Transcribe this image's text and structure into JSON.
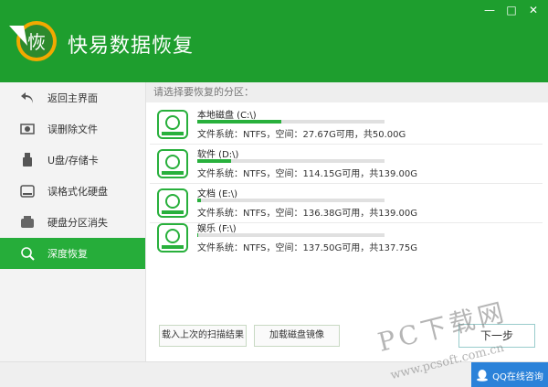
{
  "app": {
    "title": "快易数据恢复"
  },
  "window_controls": [
    "minimize-icon",
    "restore-icon",
    "close-icon"
  ],
  "sidebar": {
    "items": [
      {
        "label": "返回主界面",
        "icon": "back-arrow-icon"
      },
      {
        "label": "误删除文件",
        "icon": "deleted-file-icon"
      },
      {
        "label": "U盘/存储卡",
        "icon": "usb-drive-icon"
      },
      {
        "label": "误格式化硬盘",
        "icon": "hard-disk-icon"
      },
      {
        "label": "硬盘分区消失",
        "icon": "partition-icon"
      },
      {
        "label": "深度恢复",
        "icon": "deep-recovery-icon",
        "active": true
      }
    ]
  },
  "main": {
    "prompt": "请选择要恢复的分区：",
    "partitions": [
      {
        "name": "本地磁盘 (C:\\)",
        "info": "文件系统：NTFS，空间：27.67G可用，共50.00G",
        "used_fraction": 0.4466
      },
      {
        "name": "软件 (D:\\)",
        "info": "文件系统：NTFS，空间：114.15G可用，共139.00G",
        "used_fraction": 0.1788
      },
      {
        "name": "文档 (E:\\)",
        "info": "文件系统：NTFS，空间：136.38G可用，共139.00G",
        "used_fraction": 0.0188
      },
      {
        "name": "娱乐 (F:\\)",
        "info": "文件系统：NTFS，空间：137.50G可用，共137.75G",
        "used_fraction": 0.0018
      }
    ],
    "buttons": {
      "load_scan": "载入上次的扫描结果",
      "load_image": "加载磁盘镜像",
      "next": "下一步"
    }
  },
  "footer": {
    "qq": "QQ在线咨询"
  },
  "watermark": {
    "title": "PC下载网",
    "url": "www.pcsoft.com.cn"
  },
  "colors": {
    "brand_green": "#1e9e2e",
    "active_green": "#26ad3a",
    "bar_green": "#28b03c",
    "qq_blue": "#2b82d9"
  }
}
